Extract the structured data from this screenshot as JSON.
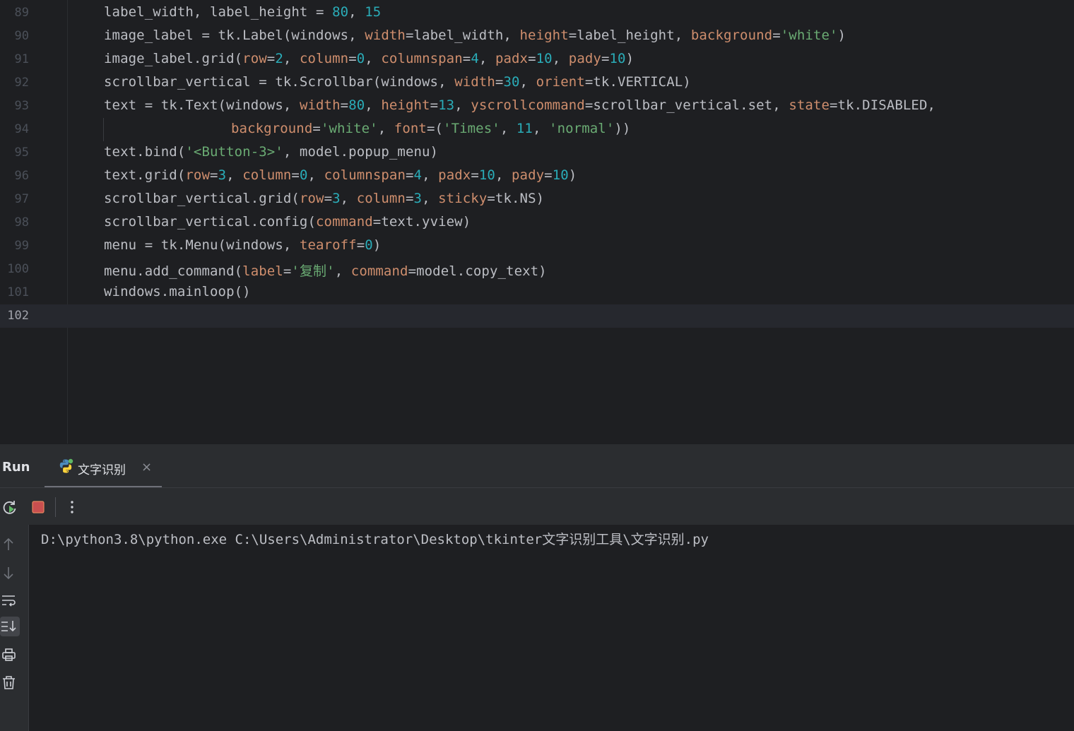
{
  "editor": {
    "lines": [
      {
        "num": "89"
      },
      {
        "num": "90"
      },
      {
        "num": "91"
      },
      {
        "num": "92"
      },
      {
        "num": "93"
      },
      {
        "num": "94"
      },
      {
        "num": "95"
      },
      {
        "num": "96"
      },
      {
        "num": "97"
      },
      {
        "num": "98"
      },
      {
        "num": "99"
      },
      {
        "num": "100"
      },
      {
        "num": "101"
      },
      {
        "num": "102"
      }
    ],
    "current_line": "102"
  },
  "run": {
    "title": "Run",
    "tab_label": "文字识别",
    "console_output": "D:\\python3.8\\python.exe C:\\Users\\Administrator\\Desktop\\tkinter文字识别工具\\文字识别.py"
  },
  "colors": {
    "background": "#1e1f22",
    "panel": "#2b2d30",
    "text": "#bcbec4",
    "param": "#cf8e6d",
    "number": "#2aacb8",
    "string": "#6aab73"
  }
}
